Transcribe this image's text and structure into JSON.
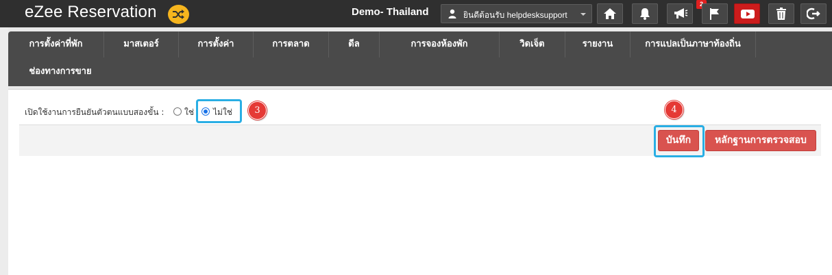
{
  "header": {
    "app_title": "eZee Reservation",
    "property_name": "Demo- Thailand",
    "user_greeting": "ยินดีต้อนรับ helpdesksupport",
    "notification_count": "2",
    "icons": [
      "home-icon",
      "bell-icon",
      "megaphone-icon",
      "flag-icon",
      "youtube-icon",
      "trash-icon",
      "logout-icon"
    ]
  },
  "nav": {
    "items": [
      {
        "label": "การตั้งค่าที่พัก"
      },
      {
        "label": "มาสเตอร์"
      },
      {
        "label": "การตั้งค่า"
      },
      {
        "label": "การตลาด"
      },
      {
        "label": "ดีล"
      },
      {
        "label": "การจองห้องพัก"
      },
      {
        "label": "วิดเจ็ต"
      },
      {
        "label": "รายงาน"
      },
      {
        "label": "การแปลเป็นภาษาท้องถิ่น"
      },
      {
        "label": "ช่องทางการขาย"
      }
    ]
  },
  "form": {
    "two_factor_label": "เปิดใช้งานการยืนยันตัวตนแบบสองขั้น :",
    "option_yes": "ใช่",
    "option_no": "ไม่ใช่",
    "selected": "ไม่ใช่"
  },
  "annotations": {
    "step_3": "3",
    "step_4": "4"
  },
  "actions": {
    "save_label": "บันทึก",
    "audit_label": "หลักฐานการตรวจสอบ"
  },
  "colors": {
    "topbar": "#2f2f2f",
    "nav": "#4a4a4a",
    "accent_yellow": "#f6b51e",
    "button_red": "#d9534f",
    "highlight_blue": "#29aee4",
    "step_red": "#e53935"
  }
}
